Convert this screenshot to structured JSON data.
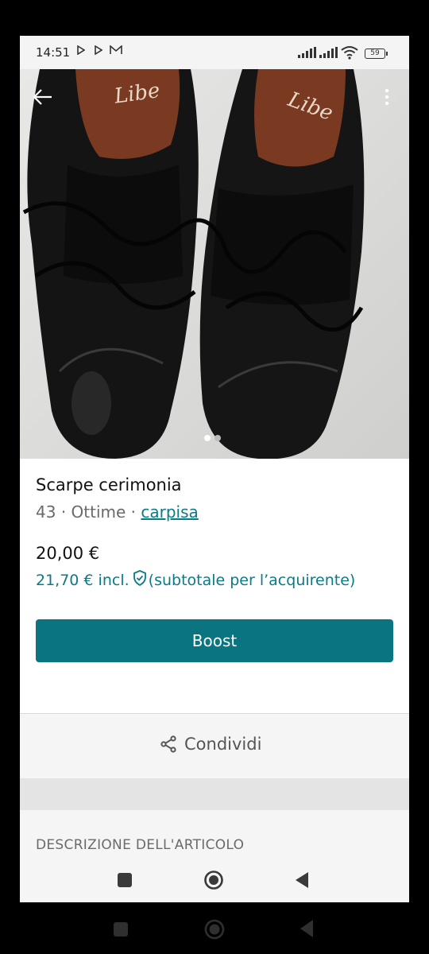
{
  "status_bar": {
    "time": "14:51",
    "battery": "59"
  },
  "photo": {
    "brand_mark": "Libe",
    "image_count": 2,
    "current_image": 1
  },
  "item": {
    "title": "Scarpe cerimonia",
    "size": "43",
    "condition": "Ottime",
    "separator": "·",
    "brand": "carpisa",
    "price": "20,00 €",
    "price_incl_amount": "21,70 € incl.",
    "price_incl_note": "(subtotale per l’acquirente)"
  },
  "actions": {
    "boost_label": "Boost",
    "share_label": "Condividi"
  },
  "description": {
    "heading": "DESCRIZIONE DELL'ARTICOLO"
  },
  "colors": {
    "accent": "#0a7580",
    "link": "#0a7a87"
  },
  "icons": [
    "back-arrow-icon",
    "more-vert-icon",
    "share-icon",
    "shield-check-icon",
    "square-icon",
    "circle-home-icon",
    "triangle-back-icon",
    "play-icon",
    "mail-icon",
    "signal-icon",
    "wifi-icon",
    "battery-icon"
  ]
}
